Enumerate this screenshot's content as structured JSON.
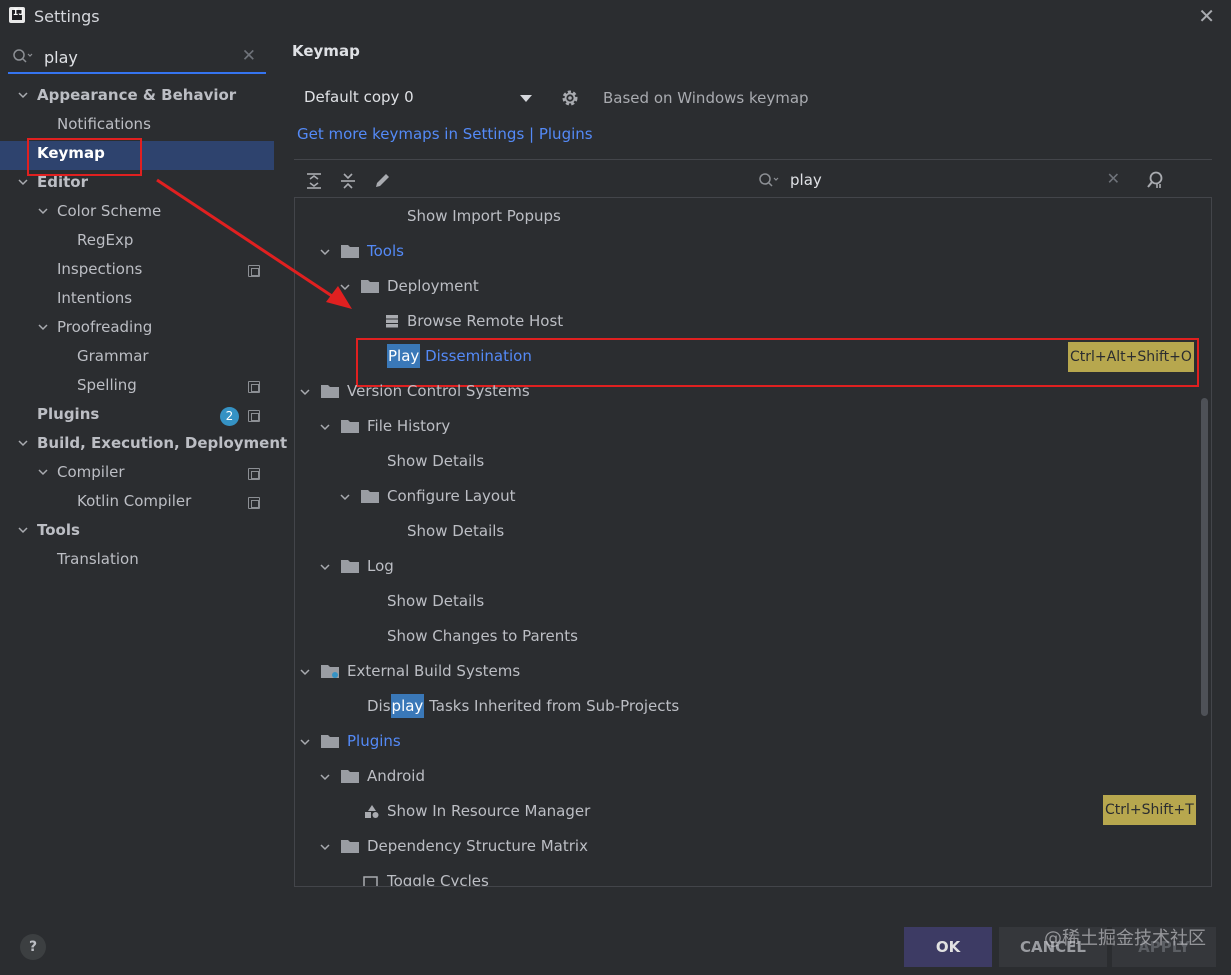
{
  "window": {
    "title": "Settings",
    "close_label": "✕"
  },
  "sidebar": {
    "search_value": "play",
    "clear_label": "✕",
    "items": [
      {
        "label": "Appearance & Behavior"
      },
      {
        "label": "Notifications"
      },
      {
        "label": "Keymap"
      },
      {
        "label": "Editor"
      },
      {
        "label": "Color Scheme"
      },
      {
        "label": "RegExp"
      },
      {
        "label": "Inspections"
      },
      {
        "label": "Intentions"
      },
      {
        "label": "Proofreading"
      },
      {
        "label": "Grammar"
      },
      {
        "label": "Spelling"
      },
      {
        "label": "Plugins",
        "badge": "2"
      },
      {
        "label": "Build, Execution, Deployment"
      },
      {
        "label": "Compiler"
      },
      {
        "label": "Kotlin Compiler"
      },
      {
        "label": "Tools"
      },
      {
        "label": "Translation"
      }
    ]
  },
  "main": {
    "title": "Keymap",
    "keymap_value": "Default copy 0",
    "based_on": "Based on Windows keymap",
    "get_more_link": "Get more keymaps in Settings | Plugins",
    "tree_search_value": "play",
    "clear_label": "✕",
    "rows": [
      {
        "label": "Show Import Popups"
      },
      {
        "label": "Tools"
      },
      {
        "label": "Deployment"
      },
      {
        "label": "Browse Remote Host"
      },
      {
        "hl": "Play",
        "label": " Dissemination",
        "shortcut": "Ctrl+Alt+Shift+O"
      },
      {
        "label": "Version Control Systems"
      },
      {
        "label": "File History"
      },
      {
        "label": "Show Details"
      },
      {
        "label": "Configure Layout"
      },
      {
        "label": "Show Details"
      },
      {
        "label": "Log"
      },
      {
        "label": "Show Details"
      },
      {
        "label": "Show Changes to Parents"
      },
      {
        "label": "External Build Systems"
      },
      {
        "pre": "Dis",
        "hl": "play",
        "label": " Tasks Inherited from Sub-Projects"
      },
      {
        "label": "Plugins"
      },
      {
        "label": "Android"
      },
      {
        "label": "Show In Resource Manager",
        "shortcut": "Ctrl+Shift+T"
      },
      {
        "label": "Dependency Structure Matrix"
      },
      {
        "label": "Toggle Cycles"
      }
    ]
  },
  "footer": {
    "help": "?",
    "ok": "OK",
    "cancel": "CANCEL",
    "apply": "APPLY",
    "watermark": "@稀土掘金技术社区"
  },
  "colors": {
    "accent": "#548af7",
    "selection": "#2e436e",
    "highlight": "#3a78b8",
    "shortcut_bg": "#b7a74e",
    "annotation_red": "#e02020"
  }
}
